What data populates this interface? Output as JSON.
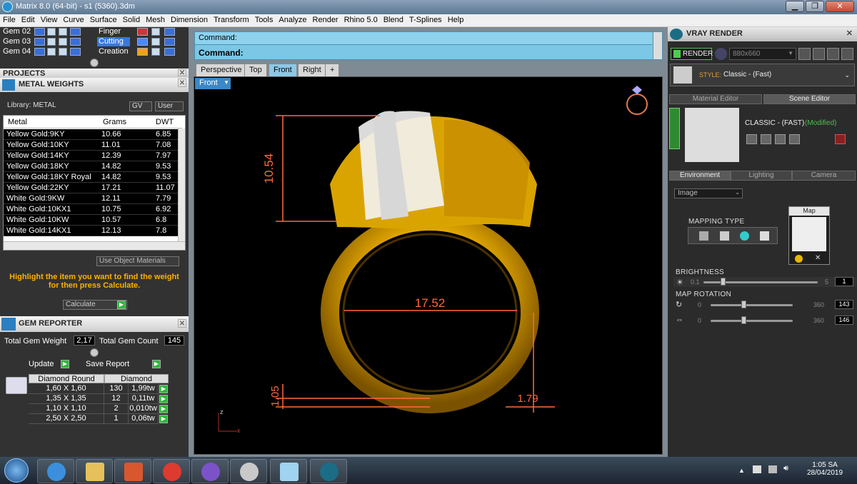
{
  "window": {
    "title": "Matrix 8.0 (64-bit) - s1 (5360).3dm",
    "min": "▁",
    "max": "❐",
    "close": "✕"
  },
  "menu": [
    "File",
    "Edit",
    "View",
    "Curve",
    "Surface",
    "Solid",
    "Mesh",
    "Dimension",
    "Transform",
    "Tools",
    "Analyze",
    "Render",
    "Rhino 5.0",
    "Blend",
    "T-Splines",
    "Help"
  ],
  "layers": {
    "gems": [
      "Gem 02",
      "Gem 03",
      "Gem 04"
    ],
    "finishes": [
      "Finger",
      "Cutting",
      "Creation"
    ],
    "colors": [
      "#3a6fd8",
      "#3a6fd8",
      "#3a6fd8"
    ],
    "finish_colors": [
      "#c73838",
      "#4a88ff",
      "#f0a21a"
    ]
  },
  "projects": {
    "header": "PROJECTS"
  },
  "metal": {
    "header": "METAL WEIGHTS",
    "library_label": "Library: METAL",
    "gv_btn": "GV",
    "user_btn": "User",
    "columns": [
      "Metal",
      "Grams",
      "DWT"
    ],
    "rows": [
      [
        "Yellow Gold:9KY",
        "10.66",
        "6.85"
      ],
      [
        "Yellow Gold:10KY",
        "11.01",
        "7.08"
      ],
      [
        "Yellow Gold:14KY",
        "12.39",
        "7.97"
      ],
      [
        "Yellow Gold:18KY",
        "14.82",
        "9.53"
      ],
      [
        "Yellow Gold:18KY Royal",
        "14.82",
        "9.53"
      ],
      [
        "Yellow Gold:22KY",
        "17.21",
        "11.07"
      ],
      [
        "White Gold:9KW",
        "12.11",
        "7.79"
      ],
      [
        "White Gold:10KX1",
        "10.75",
        "6.92"
      ],
      [
        "White Gold:10KW",
        "10.57",
        "6.8"
      ],
      [
        "White Gold:14KX1",
        "12.13",
        "7.8"
      ]
    ],
    "use_object_materials": "Use Object Materials",
    "hint": "Highlight the item you want to find the weight for then press Calculate.",
    "calculate": "Calculate"
  },
  "gem_reporter": {
    "header": "GEM REPORTER",
    "total_weight_label": "Total Gem Weight",
    "total_weight": "2,17",
    "total_count_label": "Total Gem Count",
    "total_count": "145",
    "update": "Update",
    "save_report": "Save Report",
    "table_header": [
      "Diamond Round",
      "Diamond"
    ],
    "rows": [
      [
        "1,60 X 1,60",
        "130",
        "1,99tw"
      ],
      [
        "1,35 X 1,35",
        "12",
        "0,11tw"
      ],
      [
        "1,10 X 1,10",
        "2",
        "0,010tw"
      ],
      [
        "2,50 X 2,50",
        "1",
        "0,06tw"
      ]
    ]
  },
  "command": {
    "line1": "Command:",
    "line2": "Command:"
  },
  "viewport": {
    "tabs": [
      "Perspective",
      "Top",
      "Front",
      "Right",
      "+"
    ],
    "active_label": "Front",
    "dims": {
      "height": "10.54",
      "width": "17.52",
      "band": "1.05",
      "thickness": "1.79"
    },
    "axis_z": "z",
    "axis_x": "x"
  },
  "vray": {
    "header": "VRAY RENDER",
    "render_btn": "RENDER",
    "resolution": "880x660",
    "style_label": "STYLE:",
    "style_value": "Classic - (Fast)",
    "tabs_top": [
      "Material Editor",
      "Scene Editor"
    ],
    "material_name": "CLASSIC - (FAST)",
    "modified": "(Modified)",
    "tabs_env": [
      "Environment",
      "Lighting",
      "Camera"
    ],
    "env_select": "Image",
    "mapping_type": "MAPPING TYPE",
    "map_label": "Map",
    "brightness": {
      "label": "BRIGHTNESS",
      "min": "0.1",
      "max": "5",
      "value": "1"
    },
    "map_rotation": {
      "label": "MAP ROTATION",
      "r1": {
        "min": "0",
        "max": "360",
        "value": "143"
      },
      "r2": {
        "min": "0",
        "max": "360",
        "value": "146"
      }
    }
  },
  "taskbar": {
    "time": "1:05 SA",
    "date": "28/04/2019"
  }
}
